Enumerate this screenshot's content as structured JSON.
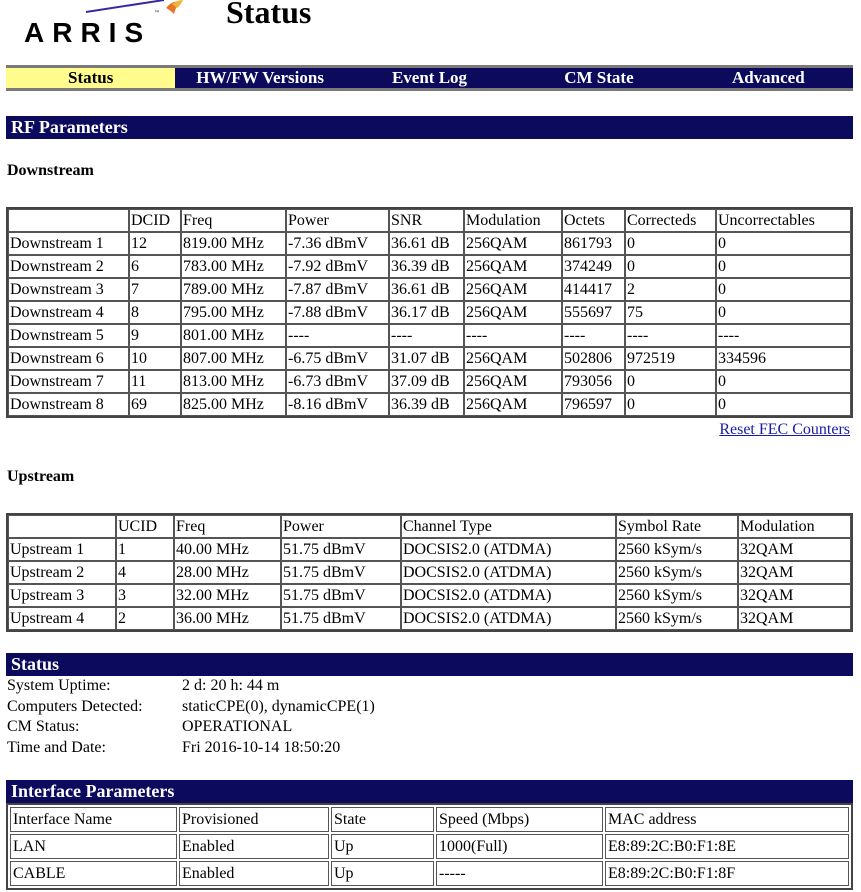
{
  "header": {
    "logo_text": "ARRIS",
    "logo_tm": "™",
    "page_title": "Status"
  },
  "nav": {
    "items": [
      {
        "label": "Status",
        "active": true
      },
      {
        "label": "HW/FW Versions",
        "active": false
      },
      {
        "label": "Event Log",
        "active": false
      },
      {
        "label": "CM State",
        "active": false
      },
      {
        "label": "Advanced",
        "active": false
      }
    ]
  },
  "colors": {
    "nav_bg": "#0b0a5c",
    "nav_active_bg": "#fffb8c",
    "section_bar_bg": "#0b0a5c",
    "link": "#1a1aa8"
  },
  "rf": {
    "title": "RF Parameters",
    "downstream": {
      "title": "Downstream",
      "headers": [
        "",
        "DCID",
        "Freq",
        "Power",
        "SNR",
        "Modulation",
        "Octets",
        "Correcteds",
        "Uncorrectables"
      ],
      "rows": [
        [
          "Downstream 1",
          "12",
          "819.00 MHz",
          "-7.36 dBmV",
          "36.61 dB",
          "256QAM",
          "861793",
          "0",
          "0"
        ],
        [
          "Downstream 2",
          "6",
          "783.00 MHz",
          "-7.92 dBmV",
          "36.39 dB",
          "256QAM",
          "374249",
          "0",
          "0"
        ],
        [
          "Downstream 3",
          "7",
          "789.00 MHz",
          "-7.87 dBmV",
          "36.61 dB",
          "256QAM",
          "414417",
          "2",
          "0"
        ],
        [
          "Downstream 4",
          "8",
          "795.00 MHz",
          "-7.88 dBmV",
          "36.17 dB",
          "256QAM",
          "555697",
          "75",
          "0"
        ],
        [
          "Downstream 5",
          "9",
          "801.00 MHz",
          "----",
          "----",
          "----",
          "----",
          "----",
          "----"
        ],
        [
          "Downstream 6",
          "10",
          "807.00 MHz",
          "-6.75 dBmV",
          "31.07 dB",
          "256QAM",
          "502806",
          "972519",
          "334596"
        ],
        [
          "Downstream 7",
          "11",
          "813.00 MHz",
          "-6.73 dBmV",
          "37.09 dB",
          "256QAM",
          "793056",
          "0",
          "0"
        ],
        [
          "Downstream 8",
          "69",
          "825.00 MHz",
          "-8.16 dBmV",
          "36.39 dB",
          "256QAM",
          "796597",
          "0",
          "0"
        ]
      ],
      "reset_link": "Reset FEC Counters"
    },
    "upstream": {
      "title": "Upstream",
      "headers": [
        "",
        "UCID",
        "Freq",
        "Power",
        "Channel Type",
        "Symbol Rate",
        "Modulation"
      ],
      "rows": [
        [
          "Upstream 1",
          "1",
          "40.00 MHz",
          "51.75 dBmV",
          "DOCSIS2.0 (ATDMA)",
          "2560 kSym/s",
          "32QAM"
        ],
        [
          "Upstream 2",
          "4",
          "28.00 MHz",
          "51.75 dBmV",
          "DOCSIS2.0 (ATDMA)",
          "2560 kSym/s",
          "32QAM"
        ],
        [
          "Upstream 3",
          "3",
          "32.00 MHz",
          "51.75 dBmV",
          "DOCSIS2.0 (ATDMA)",
          "2560 kSym/s",
          "32QAM"
        ],
        [
          "Upstream 4",
          "2",
          "36.00 MHz",
          "51.75 dBmV",
          "DOCSIS2.0 (ATDMA)",
          "2560 kSym/s",
          "32QAM"
        ]
      ]
    }
  },
  "status": {
    "title": "Status",
    "rows": [
      {
        "label": "System Uptime:",
        "value": "2 d: 20 h: 44 m"
      },
      {
        "label": "Computers Detected:",
        "value": "staticCPE(0), dynamicCPE(1)"
      },
      {
        "label": "CM Status:",
        "value": "OPERATIONAL"
      },
      {
        "label": "Time and Date:",
        "value": "Fri 2016-10-14 18:50:20"
      }
    ]
  },
  "interface": {
    "title": "Interface Parameters",
    "headers": [
      "Interface Name",
      "Provisioned",
      "State",
      "Speed (Mbps)",
      "MAC address"
    ],
    "rows": [
      [
        "LAN",
        "Enabled",
        "Up",
        "1000(Full)",
        "E8:89:2C:B0:F1:8E"
      ],
      [
        "CABLE",
        "Enabled",
        "Up",
        "-----",
        "E8:89:2C:B0:F1:8F"
      ]
    ]
  }
}
